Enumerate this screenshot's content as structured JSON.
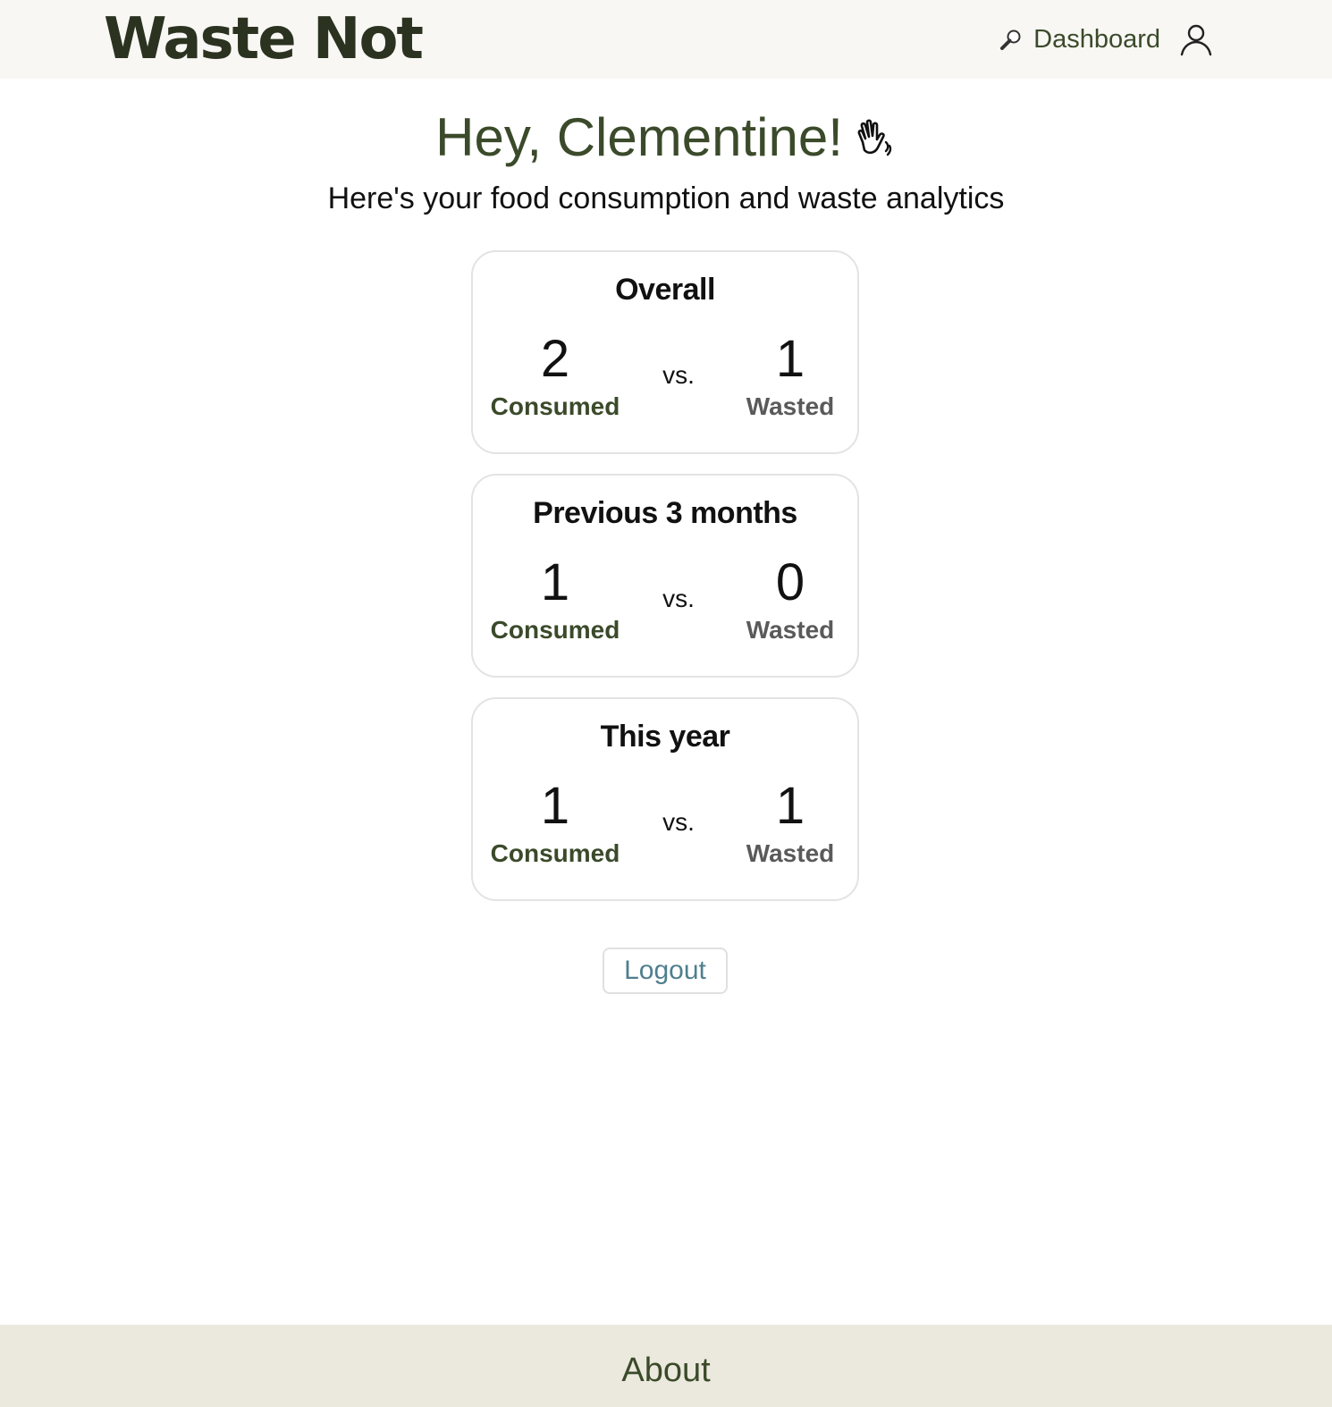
{
  "app": {
    "brand": "Waste Not"
  },
  "nav": {
    "dashboard_label": "Dashboard",
    "dashboard_icon": "magnifier-icon",
    "profile_icon": "user-icon"
  },
  "greeting": {
    "title": "Hey, Clementine!",
    "icon": "waving-hand-icon",
    "subtitle": "Here's your food consumption and waste analytics"
  },
  "stats": [
    {
      "title": "Overall",
      "consumed": "2",
      "wasted": "1",
      "consumed_label": "Consumed",
      "wasted_label": "Wasted",
      "vs": "vs."
    },
    {
      "title": "Previous 3 months",
      "consumed": "1",
      "wasted": "0",
      "consumed_label": "Consumed",
      "wasted_label": "Wasted",
      "vs": "vs."
    },
    {
      "title": "This year",
      "consumed": "1",
      "wasted": "1",
      "consumed_label": "Consumed",
      "wasted_label": "Wasted",
      "vs": "vs."
    }
  ],
  "actions": {
    "logout_label": "Logout"
  },
  "footer": {
    "about_label": "About"
  },
  "colors": {
    "brand": "#2b3320",
    "accent_green": "#3b4a2a",
    "logout_text": "#4f7f8f",
    "footer_bg": "#ebe9de",
    "header_bg": "#f8f7f4"
  }
}
